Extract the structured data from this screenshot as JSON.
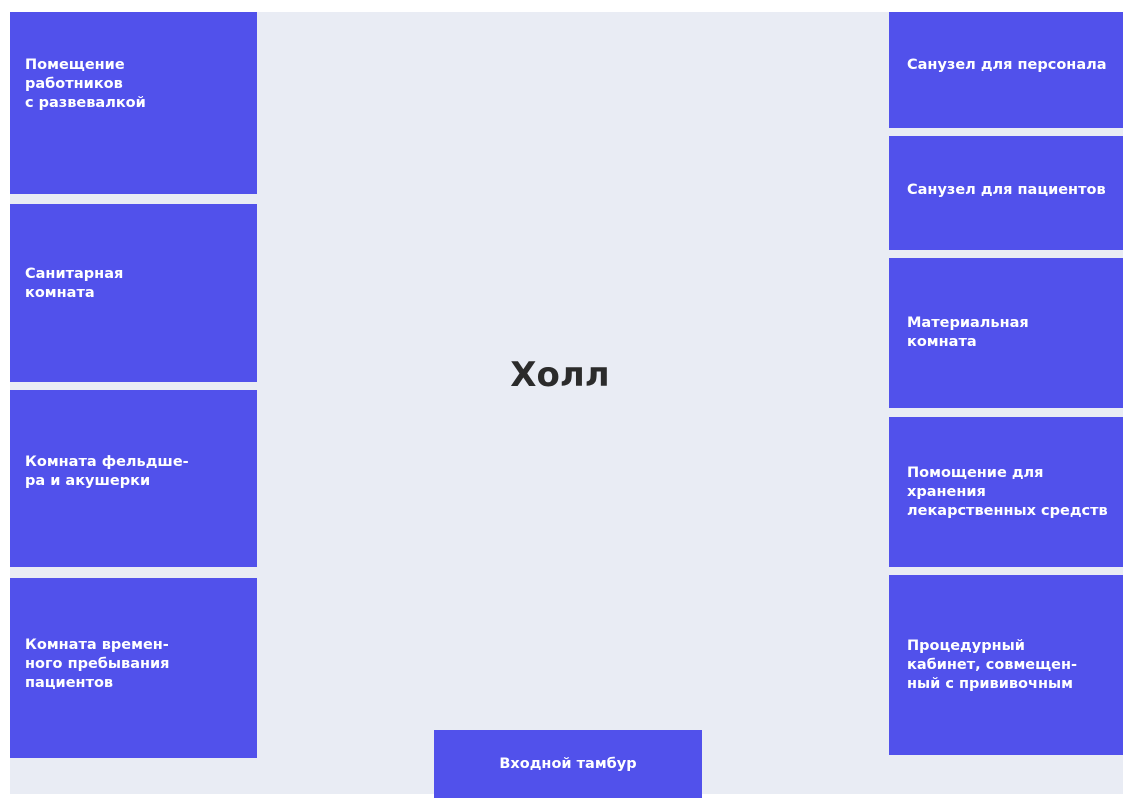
{
  "hall": {
    "label": "Холл"
  },
  "rooms": {
    "staff": "Помещение\nработников\nс развевалкой",
    "sanitary": "Санитарная\nкомната",
    "feldsher": "Комната фельдше-\nра и акушерки",
    "temp_stay": "Комната времен-\nного пребывания\nпациентов",
    "wc_staff": "Санузел для персонала",
    "wc_patients": "Санузел для пациентов",
    "material": "Материальная\nкомната",
    "storage": "Помощение для\nхранения\nлекарственных средств",
    "procedure": "Процедурный\nкабинет, совмещен-\nный с прививочным",
    "entrance": "Входной тамбур"
  },
  "colors": {
    "room": "#5151eb",
    "hall": "#e9ecf4",
    "text": "#ffffff"
  }
}
